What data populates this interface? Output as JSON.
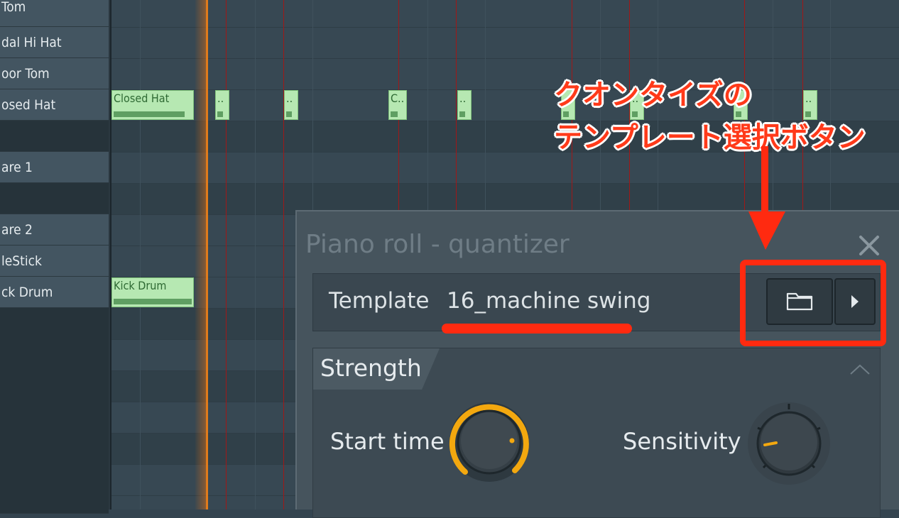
{
  "keyboard": {
    "labels": [
      "Tom",
      "dal Hi Hat",
      "oor Tom",
      "osed Hat",
      "",
      "are 1",
      "",
      "are 2",
      "leStick",
      "ck Drum"
    ]
  },
  "notes": [
    {
      "label": "Closed Hat"
    },
    {
      "label": ".."
    },
    {
      "label": ".."
    },
    {
      "label": "C.."
    },
    {
      "label": ".."
    },
    {
      "label": ".."
    },
    {
      "label": ".."
    },
    {
      "label": ".."
    },
    {
      "label": ".."
    },
    {
      "label": "Kick Drum"
    }
  ],
  "dialog": {
    "title": "Piano roll - quantizer",
    "template_label": "Template",
    "template_value": "16_machine swing",
    "strength_label": "Strength",
    "start_time_label": "Start time",
    "sensitivity_label": "Sensitivity"
  },
  "annotation": {
    "line1": "クオンタイズの",
    "line2": "テンプレート選択ボタン"
  },
  "colors": {
    "accent_orange": "#f3a80f",
    "annotation_red": "#ff2a10",
    "note_green": "#b6e8b2",
    "grid_bar_line": "#a01818"
  },
  "icons": [
    "folder-icon",
    "play-arrow-icon",
    "close-icon",
    "chevron-up-icon"
  ]
}
